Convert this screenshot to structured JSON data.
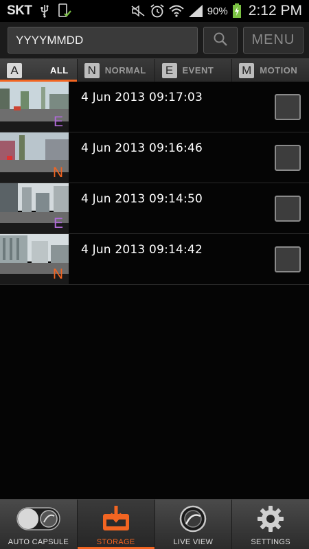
{
  "status_bar": {
    "carrier": "SKT",
    "battery_percent": "90%",
    "time": "2:12 PM",
    "icons": [
      "usb-icon",
      "phone-check-icon",
      "mute-icon",
      "alarm-icon",
      "wifi-icon",
      "signal-icon",
      "battery-charging-icon"
    ]
  },
  "search": {
    "placeholder": "YYYYMMDD",
    "icon": "search-icon",
    "menu_label": "MENU"
  },
  "filter_tabs": [
    {
      "letter": "A",
      "label": "ALL",
      "active": true
    },
    {
      "letter": "N",
      "label": "NORMAL",
      "active": false
    },
    {
      "letter": "E",
      "label": "EVENT",
      "active": false
    },
    {
      "letter": "M",
      "label": "MOTION",
      "active": false
    }
  ],
  "videos": [
    {
      "timestamp": "4 Jun 2013 09:17:03",
      "type": "E",
      "checked": false
    },
    {
      "timestamp": "4 Jun 2013 09:16:46",
      "type": "N",
      "checked": false
    },
    {
      "timestamp": "4 Jun 2013 09:14:50",
      "type": "E",
      "checked": false
    },
    {
      "timestamp": "4 Jun 2013 09:14:42",
      "type": "N",
      "checked": false
    }
  ],
  "bottom_nav": [
    {
      "label": "AUTO CAPSULE",
      "icon": "capsule-toggle-icon",
      "active": false
    },
    {
      "label": "STORAGE",
      "icon": "storage-download-icon",
      "active": true
    },
    {
      "label": "LIVE VIEW",
      "icon": "live-view-lens-icon",
      "active": false
    },
    {
      "label": "SETTINGS",
      "icon": "gear-icon",
      "active": false
    }
  ],
  "colors": {
    "accent": "#f26522",
    "badge_event": "#b06ad8",
    "badge_normal": "#f26522"
  }
}
